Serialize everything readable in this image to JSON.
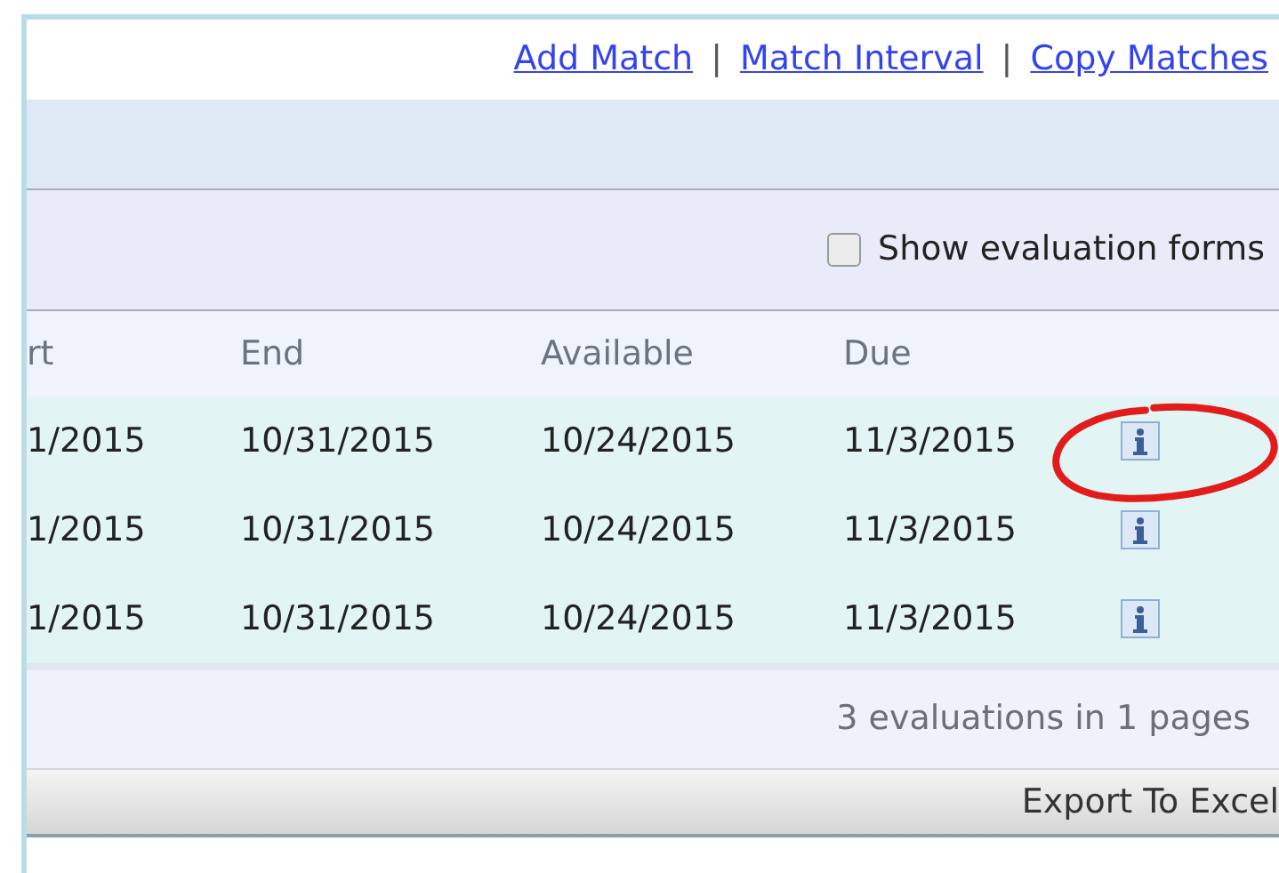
{
  "links": [
    "Add Match",
    "Match Interval",
    "Copy Matches"
  ],
  "separators": [
    "|",
    "|"
  ],
  "filter": {
    "label": "Show evaluation forms",
    "checked": false
  },
  "table": {
    "columns": [
      "rt",
      "End",
      "Available",
      "Due"
    ],
    "rows": [
      {
        "cells": [
          "1/2015",
          "10/31/2015",
          "10/24/2015",
          "11/3/2015"
        ]
      },
      {
        "cells": [
          "1/2015",
          "10/31/2015",
          "10/24/2015",
          "11/3/2015"
        ]
      },
      {
        "cells": [
          "1/2015",
          "10/31/2015",
          "10/24/2015",
          "11/3/2015"
        ]
      }
    ]
  },
  "pager": "3 evaluations in 1 pages",
  "export_button": "Export To Excel"
}
